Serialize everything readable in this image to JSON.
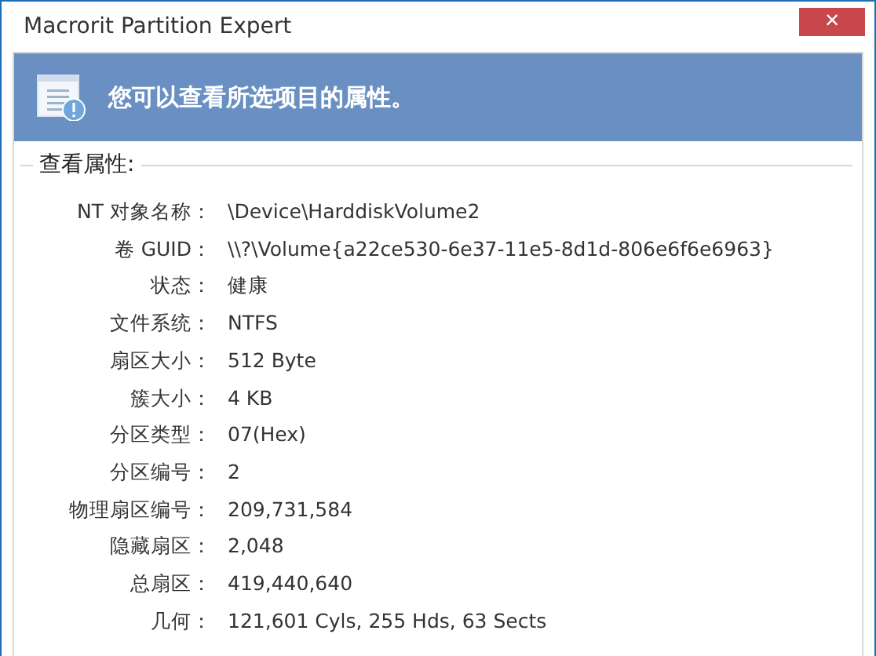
{
  "window": {
    "title": "Macrorit Partition Expert",
    "close": "×"
  },
  "banner": {
    "message": "您可以查看所选项目的属性。"
  },
  "group": {
    "title": "查看属性:"
  },
  "properties": [
    {
      "label": "NT 对象名称：",
      "value": "\\Device\\HarddiskVolume2"
    },
    {
      "label": "卷 GUID：",
      "value": "\\\\?\\Volume{a22ce530-6e37-11e5-8d1d-806e6f6e6963}"
    },
    {
      "label": "状态：",
      "value": "健康"
    },
    {
      "label": "文件系统：",
      "value": "NTFS"
    },
    {
      "label": "扇区大小：",
      "value": "512 Byte"
    },
    {
      "label": "簇大小：",
      "value": "4 KB"
    },
    {
      "label": "分区类型：",
      "value": "07(Hex)"
    },
    {
      "label": "分区编号：",
      "value": "2"
    },
    {
      "label": "物理扇区编号：",
      "value": "209,731,584"
    },
    {
      "label": "隐藏扇区：",
      "value": "2,048"
    },
    {
      "label": "总扇区：",
      "value": "419,440,640"
    },
    {
      "label": "几何：",
      "value": "121,601 Cyls, 255 Hds, 63 Sects"
    }
  ]
}
